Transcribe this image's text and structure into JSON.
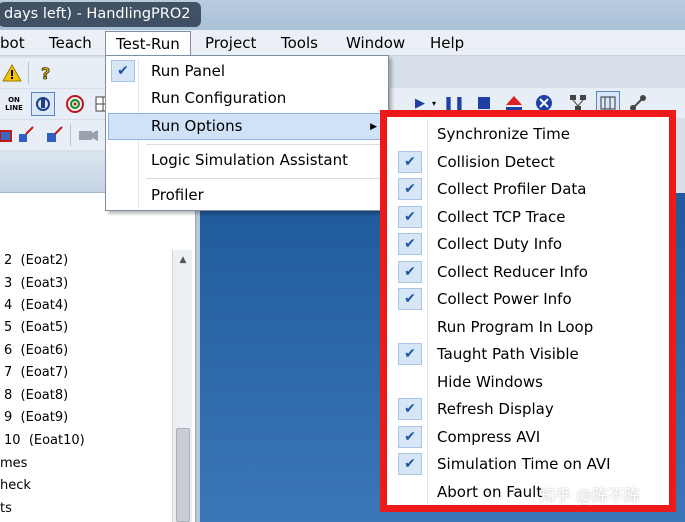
{
  "window": {
    "title": "days left) - HandlingPRO2"
  },
  "menubar": {
    "items": [
      {
        "label": "bot"
      },
      {
        "label": "Teach"
      },
      {
        "label": "Test-Run"
      },
      {
        "label": "Project"
      },
      {
        "label": "Tools"
      },
      {
        "label": "Window"
      },
      {
        "label": "Help"
      }
    ]
  },
  "toolbar": {
    "online_line1": "ON",
    "online_line2": "LINE"
  },
  "testrun_menu": {
    "items": [
      {
        "label": "Run Panel",
        "checked": true
      },
      {
        "label": "Run Configuration",
        "checked": false
      },
      {
        "label": "Run Options",
        "checked": false,
        "submenu": true,
        "highlighted": true
      },
      {
        "label": "Logic Simulation Assistant",
        "checked": false
      },
      {
        "label": "Profiler",
        "checked": false
      }
    ],
    "submenu_arrow": "▶"
  },
  "run_options": {
    "items": [
      {
        "label": "Synchronize Time",
        "checked": false
      },
      {
        "label": "Collision Detect",
        "checked": true
      },
      {
        "label": "Collect Profiler Data",
        "checked": true
      },
      {
        "label": "Collect TCP Trace",
        "checked": true
      },
      {
        "label": "Collect Duty Info",
        "checked": true
      },
      {
        "label": "Collect Reducer Info",
        "checked": true
      },
      {
        "label": "Collect Power Info",
        "checked": true
      },
      {
        "label": "Run Program In Loop",
        "checked": false
      },
      {
        "label": "Taught Path Visible",
        "checked": true
      },
      {
        "label": "Hide Windows",
        "checked": false
      },
      {
        "label": "Refresh Display",
        "checked": true
      },
      {
        "label": "Compress AVI",
        "checked": true
      },
      {
        "label": "Simulation Time on AVI",
        "checked": true
      },
      {
        "label": "Abort on Fault",
        "checked": false
      }
    ],
    "check_glyph": "✔"
  },
  "left_list": {
    "items": [
      {
        "num": "2",
        "name": "(Eoat2)"
      },
      {
        "num": "3",
        "name": "(Eoat3)"
      },
      {
        "num": "4",
        "name": "(Eoat4)"
      },
      {
        "num": "5",
        "name": "(Eoat5)"
      },
      {
        "num": "6",
        "name": "(Eoat6)"
      },
      {
        "num": "7",
        "name": "(Eoat7)"
      },
      {
        "num": "8",
        "name": "(Eoat8)"
      },
      {
        "num": "9",
        "name": "(Eoat9)"
      },
      {
        "num": "10",
        "name": "(Eoat10)"
      }
    ],
    "tail_items": [
      "mes",
      "heck",
      "ts"
    ]
  },
  "watermark": "知乎 @陈不陈",
  "colors": {
    "highlight_border": "#ee1a1a",
    "workspace": "#2a65a8",
    "check": "#1d57a5"
  }
}
